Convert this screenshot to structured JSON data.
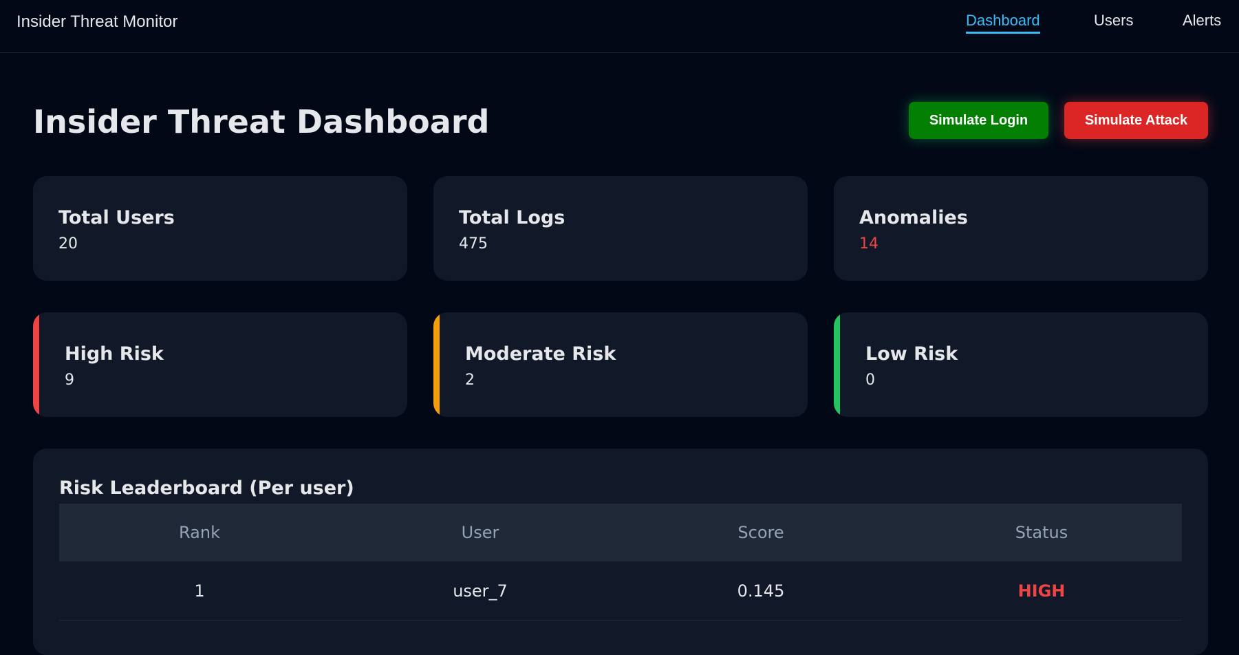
{
  "nav": {
    "brand": "Insider Threat Monitor",
    "links": [
      {
        "label": "Dashboard",
        "active": true
      },
      {
        "label": "Users",
        "active": false
      },
      {
        "label": "Alerts",
        "active": false
      }
    ]
  },
  "header": {
    "title": "Insider Threat Dashboard",
    "simulate_login_label": "Simulate Login",
    "simulate_attack_label": "Simulate Attack"
  },
  "stats": {
    "total_users": {
      "label": "Total Users",
      "value": "20"
    },
    "total_logs": {
      "label": "Total Logs",
      "value": "475"
    },
    "anomalies": {
      "label": "Anomalies",
      "value": "14"
    }
  },
  "risk": {
    "high": {
      "label": "High Risk",
      "value": "9"
    },
    "moderate": {
      "label": "Moderate Risk",
      "value": "2"
    },
    "low": {
      "label": "Low Risk",
      "value": "0"
    }
  },
  "leaderboard": {
    "title": "Risk Leaderboard (Per user)",
    "columns": [
      "Rank",
      "User",
      "Score",
      "Status"
    ],
    "rows": [
      {
        "rank": "1",
        "user": "user_7",
        "score": "0.145",
        "status": "HIGH"
      }
    ]
  },
  "colors": {
    "accent_active": "#38bdf8",
    "high": "#ef4444",
    "moderate": "#f59e0b",
    "low": "#22c55e",
    "login_button": "#038003",
    "attack_button": "#dc2626"
  }
}
